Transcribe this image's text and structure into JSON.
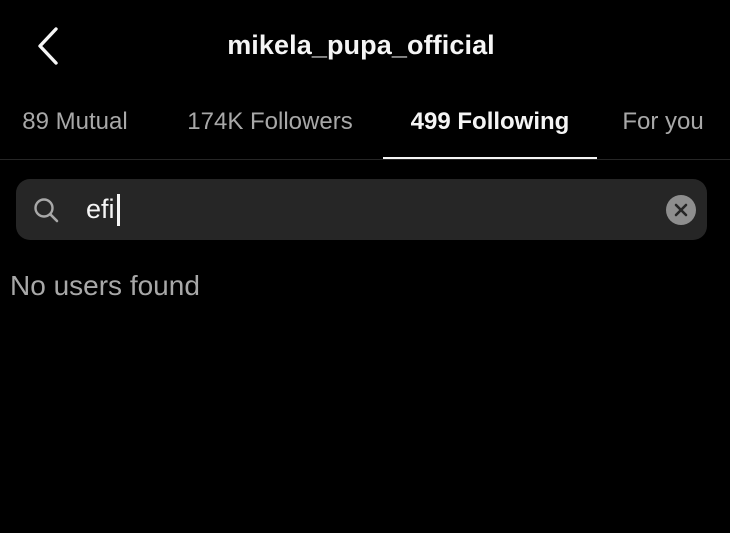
{
  "header": {
    "title": "mikela_pupa_official",
    "back_icon": "chevron-left-icon"
  },
  "tabs": [
    {
      "label": "89 Mutual",
      "active": false
    },
    {
      "label": "174K Followers",
      "active": false
    },
    {
      "label": "499 Following",
      "active": true
    },
    {
      "label": "For you",
      "active": false
    }
  ],
  "search": {
    "value": "efi",
    "placeholder": "Search",
    "icon": "search-icon",
    "clear_icon": "clear-icon"
  },
  "results": {
    "empty_message": "No users found"
  },
  "colors": {
    "background": "#000000",
    "primary_text": "#f5f5f5",
    "secondary_text": "#a8a8a8",
    "search_background": "#262626"
  }
}
